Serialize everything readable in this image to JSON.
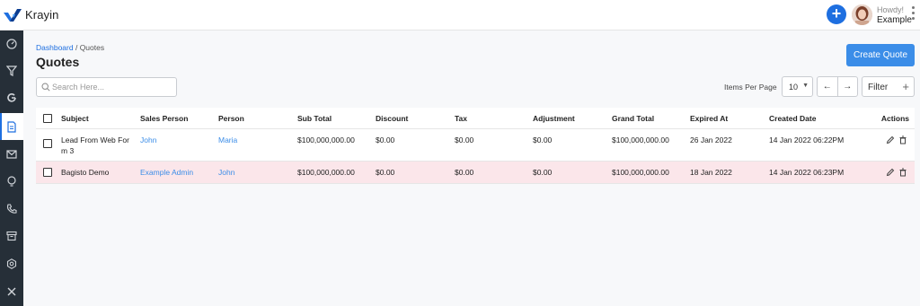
{
  "app": {
    "name": "Krayin"
  },
  "user": {
    "greeting": "Howdy!",
    "name": "Example"
  },
  "sidebar": {
    "items": [
      {
        "icon": "dashboard-icon"
      },
      {
        "icon": "filter-icon"
      },
      {
        "icon": "google-icon"
      },
      {
        "icon": "quote-document-icon",
        "active": true
      },
      {
        "icon": "mail-icon"
      },
      {
        "icon": "bulb-icon"
      },
      {
        "icon": "phone-icon"
      },
      {
        "icon": "archive-box-icon"
      },
      {
        "icon": "settings-icon"
      },
      {
        "icon": "tools-icon"
      }
    ]
  },
  "breadcrumb": {
    "root": "Dashboard",
    "separator": " / ",
    "current": "Quotes"
  },
  "page": {
    "title": "Quotes",
    "create_label": "Create Quote"
  },
  "search": {
    "placeholder": "Search Here..."
  },
  "pagination": {
    "items_per_page_label": "Items Per Page",
    "items_per_page_value": "10",
    "prev": "←",
    "next": "→"
  },
  "filter": {
    "label": "Filter",
    "plus": "+"
  },
  "table": {
    "headers": {
      "subject": "Subject",
      "sales_person": "Sales Person",
      "person": "Person",
      "sub_total": "Sub Total",
      "discount": "Discount",
      "tax": "Tax",
      "adjustment": "Adjustment",
      "grand_total": "Grand Total",
      "expired_at": "Expired At",
      "created_date": "Created Date",
      "actions": "Actions"
    },
    "rows": [
      {
        "subject_line1": "Lead From Web For",
        "subject_line2": "m 3",
        "sales_person": "John",
        "person": "Maria",
        "sub_total": "$100,000,000.00",
        "discount": "$0.00",
        "tax": "$0.00",
        "adjustment": "$0.00",
        "grand_total": "$100,000,000.00",
        "expired_at": "26 Jan 2022",
        "created_date": "14 Jan 2022 06:22PM"
      },
      {
        "subject": "Bagisto Demo",
        "sales_person": "Example Admin",
        "person": "John",
        "sub_total": "$100,000,000.00",
        "discount": "$0.00",
        "tax": "$0.00",
        "adjustment": "$0.00",
        "grand_total": "$100,000,000.00",
        "expired_at": "18 Jan 2022",
        "created_date": "14 Jan 2022 06:23PM"
      }
    ]
  },
  "colors": {
    "accent": "#1e6fe0",
    "button": "#3b8de8",
    "sidebar_bg": "#262f38",
    "highlight_row": "#fbe6ea"
  }
}
